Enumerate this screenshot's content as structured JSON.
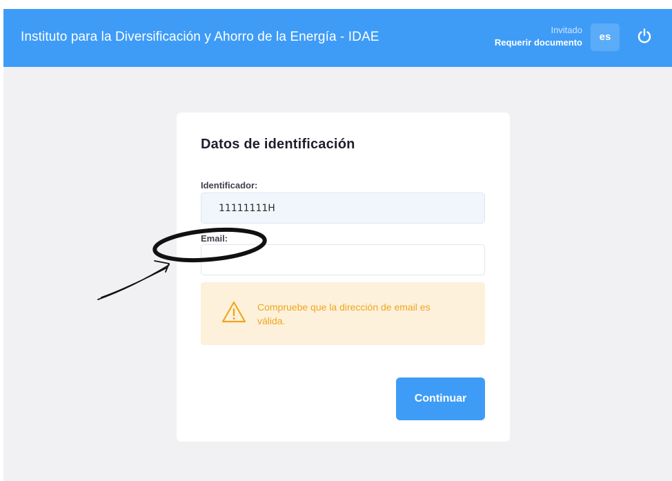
{
  "header": {
    "title": "Instituto para la Diversificación y Ahorro de la Energía - IDAE",
    "user_role": "Invitado",
    "user_action": "Requerir documento",
    "language": "es"
  },
  "form": {
    "title": "Datos de identificación",
    "identifier_label": "Identificador:",
    "identifier_value": "11111111H",
    "email_label": "Email:",
    "email_value": "",
    "warning_text": "Compruebe que la dirección de email es válida.",
    "continue_label": "Continuar"
  },
  "colors": {
    "header_blue": "#3e9cf7",
    "warning_orange": "#f0a51a",
    "warning_bg": "#fdf1dc"
  },
  "icons": {
    "power": "power-icon",
    "warning": "warning-triangle-icon"
  }
}
